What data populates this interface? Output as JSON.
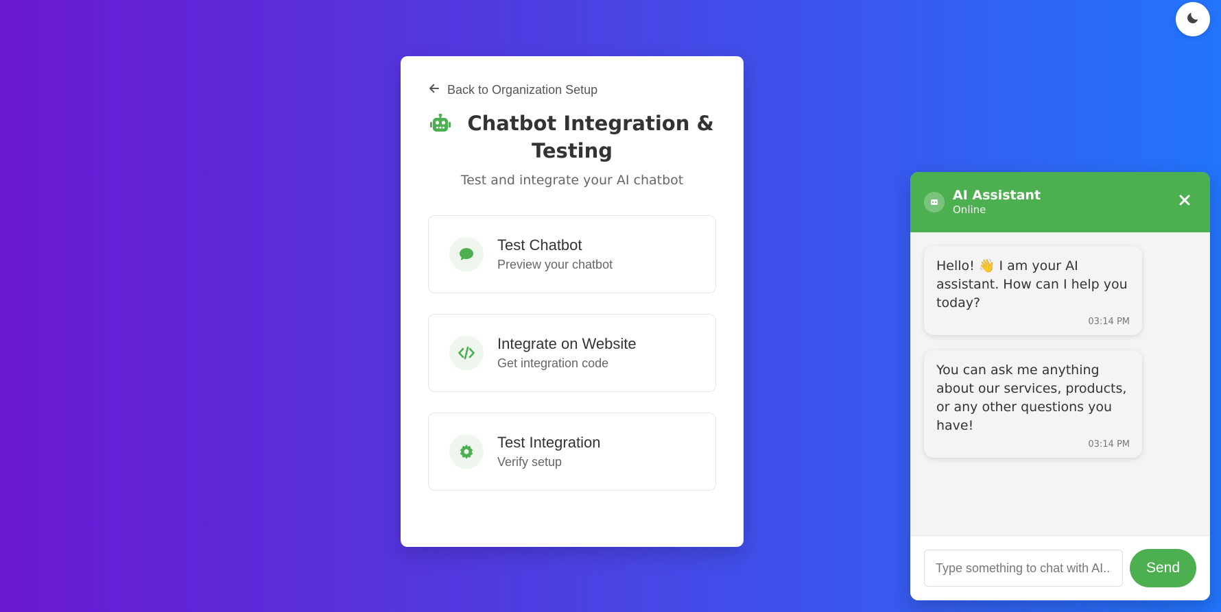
{
  "theme_toggle": {
    "icon": "moon-icon"
  },
  "card": {
    "back_link": "Back to Organization Setup",
    "title": "Chatbot Integration & Testing",
    "subtitle": "Test and integrate your AI chatbot",
    "options": [
      {
        "title": "Test Chatbot",
        "desc": "Preview your chatbot",
        "icon": "chat-bubble-icon"
      },
      {
        "title": "Integrate on Website",
        "desc": "Get integration code",
        "icon": "code-icon"
      },
      {
        "title": "Test Integration",
        "desc": "Verify setup",
        "icon": "gear-icon"
      }
    ]
  },
  "chat": {
    "header_title": "AI Assistant",
    "header_status": "Online",
    "messages": [
      {
        "text": "Hello! 👋 I am your AI assistant. How can I help you today?",
        "time": "03:14 PM"
      },
      {
        "text": "You can ask me anything about our services, products, or any other questions you have!",
        "time": "03:14 PM"
      }
    ],
    "input_placeholder": "Type something to chat with AI...",
    "input_value": "",
    "send_label": "Send"
  },
  "colors": {
    "accent": "#4caf50",
    "gradient_start": "#6a18d2",
    "gradient_end": "#2274fb"
  }
}
